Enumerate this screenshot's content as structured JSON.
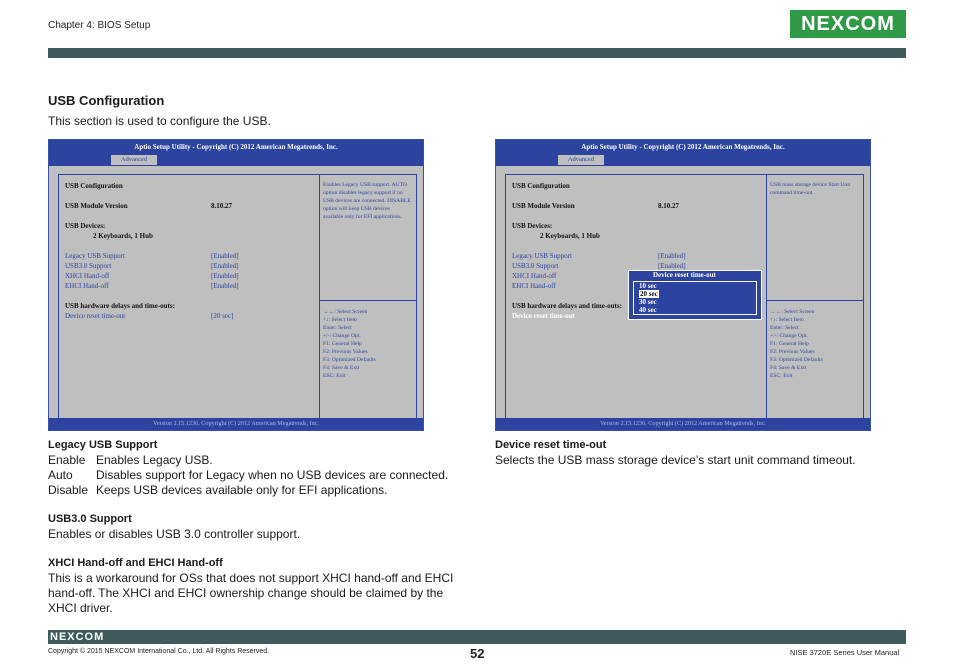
{
  "header": {
    "chapter": "Chapter 4: BIOS Setup",
    "logo": "NEXCOM"
  },
  "section": {
    "title": "USB Configuration",
    "intro": "This section is used to configure the USB."
  },
  "bios": {
    "title": "Aptio Setup Utility - Copyright (C) 2012 American Megatrends, Inc.",
    "tab": "Advanced",
    "footer": "Version 2.15.1236. Copyright (C) 2012 American Megatrends, Inc.",
    "usb_config": "USB Configuration",
    "module_label": "USB Module Version",
    "module_value": "8.10.27",
    "devices_label": "USB Devices:",
    "devices_value": "2 Keyboards, 1 Hub",
    "items": [
      {
        "label": "Legacy USB Support",
        "value": "[Enabled]"
      },
      {
        "label": "USB3.0 Support",
        "value": "[Enabled]"
      },
      {
        "label": "XHCI Hand-off",
        "value": "[Enabled]"
      },
      {
        "label": "EHCI Hand-off",
        "value": "[Enabled]"
      }
    ],
    "delays_label": "USB hardware delays and time-outs:",
    "reset_label": "Device reset time-out",
    "reset_value": "[20 sec]",
    "help_left": "Enables Legacy USB support. AUTO option disables legacy support if no USB devices are connected. DISABLE option will keep USB devices available only for EFI applications.",
    "help_right": "USB mass storage device Start Unit command time-out.",
    "keys": [
      "→←: Select Screen",
      "↑↓: Select Item",
      "Enter: Select",
      "+/-: Change Opt.",
      "F1: General Help",
      "F2: Previous Values",
      "F3: Optimized Defaults",
      "F4: Save & Exit",
      "ESC: Exit"
    ],
    "popup": {
      "title": "Device reset time-out",
      "options": [
        "10 sec",
        "20 sec",
        "30 sec",
        "40 sec"
      ]
    }
  },
  "left_text": {
    "legacy_title": "Legacy USB Support",
    "legacy_rows": [
      {
        "k": "Enable",
        "v": "Enables Legacy USB."
      },
      {
        "k": "Auto",
        "v": "Disables support for Legacy when no USB devices are connected."
      },
      {
        "k": "Disable",
        "v": "Keeps USB devices available only for EFI applications."
      }
    ],
    "usb3_title": "USB3.0 Support",
    "usb3_desc": "Enables or disables USB 3.0 controller support.",
    "xhci_title": "XHCI Hand-off and EHCI Hand-off",
    "xhci_desc": "This is a workaround for OSs that does not support XHCI hand-off and EHCI hand-off. The XHCI and EHCI ownership change should be claimed by the XHCI driver."
  },
  "right_text": {
    "reset_title": "Device reset time-out",
    "reset_desc": "Selects the USB mass storage device’s start unit command timeout."
  },
  "footer": {
    "logo": "NEXCOM",
    "page": "52",
    "copyright": "Copyright © 2015 NEXCOM International Co., Ltd. All Rights Reserved.",
    "manual": "NISE 3720E Series User Manual"
  }
}
